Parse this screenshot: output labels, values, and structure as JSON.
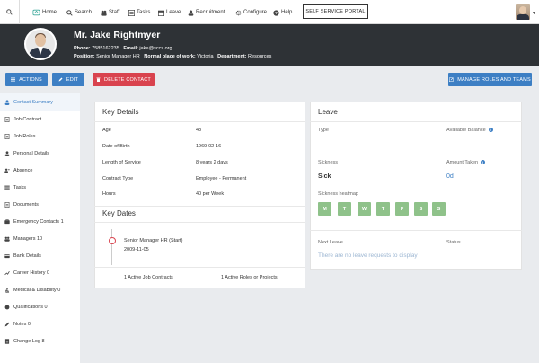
{
  "topnav": {
    "items": [
      {
        "label": "Home",
        "icon": "home-icon"
      },
      {
        "label": "Search",
        "icon": "search-icon"
      },
      {
        "label": "Staff",
        "icon": "staff-icon"
      },
      {
        "label": "Tasks",
        "icon": "tasks-icon"
      },
      {
        "label": "Leave",
        "icon": "leave-icon"
      },
      {
        "label": "Recruitment",
        "icon": "recruitment-icon"
      },
      {
        "label": "Configure",
        "icon": "gear-icon"
      },
      {
        "label": "Help",
        "icon": "help-icon"
      }
    ],
    "self_service": "SELF SERVICE PORTAL"
  },
  "profile": {
    "name": "Mr. Jake Rightmyer",
    "phone_label": "Phone:",
    "phone": "7585162235",
    "email_label": "Email:",
    "email": "jake@sccs.org",
    "position_label": "Position:",
    "position": "Senior Manager HR",
    "workplace_label": "Normal place of work:",
    "workplace": "Victoria",
    "department_label": "Department:",
    "department": "Resources"
  },
  "actions": {
    "actions": "ACTIONS",
    "edit": "EDIT",
    "delete": "DELETE CONTACT",
    "manage": "MANAGE ROLES AND TEAMS"
  },
  "sidebar": {
    "items": [
      {
        "label": "Contact Summary",
        "icon": "person-icon"
      },
      {
        "label": "Job Contract",
        "icon": "document-icon"
      },
      {
        "label": "Job Roles",
        "icon": "document-icon"
      },
      {
        "label": "Personal Details",
        "icon": "person-icon"
      },
      {
        "label": "Absence",
        "icon": "absence-icon"
      },
      {
        "label": "Tasks",
        "icon": "tasks-icon"
      },
      {
        "label": "Documents",
        "icon": "document-icon"
      },
      {
        "label": "Emergency Contacts 1",
        "icon": "emergency-icon"
      },
      {
        "label": "Managers 10",
        "icon": "managers-icon"
      },
      {
        "label": "Bank Details",
        "icon": "bank-icon"
      },
      {
        "label": "Career History 0",
        "icon": "career-icon"
      },
      {
        "label": "Medical & Disability 0",
        "icon": "medical-icon"
      },
      {
        "label": "Qualifications 0",
        "icon": "qualification-icon"
      },
      {
        "label": "Notes 0",
        "icon": "notes-icon"
      },
      {
        "label": "Change Log 8",
        "icon": "changelog-icon"
      }
    ]
  },
  "key_details": {
    "title": "Key Details",
    "rows": [
      {
        "label": "Age",
        "value": "48"
      },
      {
        "label": "Date of Birth",
        "value": "1969-02-16"
      },
      {
        "label": "Length of Service",
        "value": "8 years 2 days"
      },
      {
        "label": "Contract Type",
        "value": "Employee - Permanent"
      },
      {
        "label": "Hours",
        "value": "40 per Week"
      }
    ]
  },
  "key_dates": {
    "title": "Key Dates",
    "event_title": "Senior Manager HR (Start)",
    "event_date": "2009-11-05",
    "footer_left": "1 Active Job Contracts",
    "footer_right": "1 Active Roles or Projects"
  },
  "leave": {
    "title": "Leave",
    "type_label": "Type",
    "balance_label": "Available Balance",
    "sickness_label": "Sickness",
    "amount_label": "Amount Taken",
    "sick_value": "Sick",
    "amount_value": "0d",
    "heatmap_label": "Sickness heatmap",
    "days": [
      "M",
      "T",
      "W",
      "T",
      "F",
      "S",
      "S"
    ],
    "next_leave_label": "Next Leave",
    "status_label": "Status",
    "empty_text": "There are no leave requests to display"
  },
  "colors": {
    "accent": "#3d7fc4",
    "danger": "#d9434e",
    "header": "#2e3236",
    "heatmap": "#8fc28a"
  }
}
